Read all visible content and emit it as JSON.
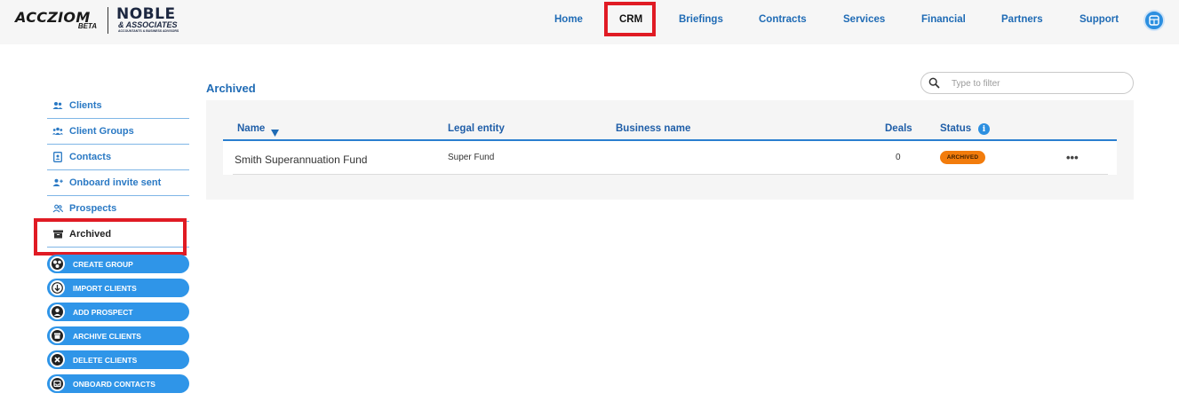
{
  "header": {
    "logo_primary": "ACCZIOM",
    "logo_beta": "BETA",
    "logo_partner": "NOBLE",
    "logo_partner_sub": "& ASSOCIATES",
    "logo_partner_tagline": "ACCOUNTANTS & BUSINESS ADVISORS",
    "nav": [
      {
        "label": "Home",
        "active": false
      },
      {
        "label": "CRM",
        "active": true
      },
      {
        "label": "Briefings",
        "active": false
      },
      {
        "label": "Contracts",
        "active": false
      },
      {
        "label": "Services",
        "active": false
      },
      {
        "label": "Financial",
        "active": false
      },
      {
        "label": "Partners",
        "active": false
      },
      {
        "label": "Support",
        "active": false
      }
    ],
    "app_icon": "dashboard-icon"
  },
  "sidebar": {
    "items": [
      {
        "label": "Clients",
        "icon": "users-icon"
      },
      {
        "label": "Client Groups",
        "icon": "group-icon"
      },
      {
        "label": "Contacts",
        "icon": "contact-card-icon"
      },
      {
        "label": "Onboard invite sent",
        "icon": "user-plus-icon"
      },
      {
        "label": "Prospects",
        "icon": "prospects-icon"
      },
      {
        "label": "Archived",
        "icon": "archive-box-icon",
        "active": true
      }
    ],
    "actions": [
      {
        "label": "CREATE GROUP",
        "icon": "group-circles-icon"
      },
      {
        "label": "IMPORT CLIENTS",
        "icon": "download-arrow-icon"
      },
      {
        "label": "ADD PROSPECT",
        "icon": "person-icon"
      },
      {
        "label": "ARCHIVE CLIENTS",
        "icon": "archive-icon"
      },
      {
        "label": "DELETE CLIENTS",
        "icon": "close-circle-icon"
      },
      {
        "label": "ONBOARD CONTACTS",
        "icon": "inbox-icon"
      }
    ]
  },
  "main": {
    "title": "Archived",
    "filter": {
      "placeholder": "Type to filter",
      "value": ""
    },
    "table": {
      "columns": [
        "Name",
        "Legal entity",
        "Business name",
        "Deals",
        "Status"
      ],
      "rows": [
        {
          "name": "Smith Superannuation Fund",
          "legal_entity": "Super Fund",
          "business_name": "",
          "deals": "0",
          "status": "ARCHIVED"
        }
      ]
    }
  },
  "colors": {
    "accent": "#1f6bb5",
    "button_blue": "#2f95e8",
    "highlight_red": "#e01b24",
    "status_orange": "#f27c0c"
  }
}
